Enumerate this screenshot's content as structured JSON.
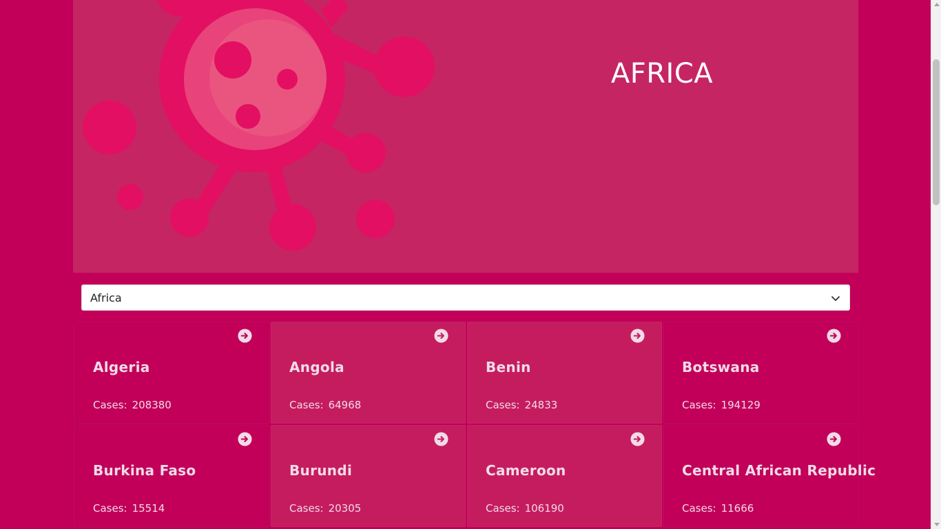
{
  "hero": {
    "title": "AFRICA",
    "illustration": "virus-icon"
  },
  "region_select": {
    "selected": "Africa",
    "icon": "chevron-down-icon"
  },
  "cards": [
    {
      "name": "Algeria",
      "cases_label": "Cases:",
      "cases": "208380",
      "icon": "arrow-right-circle-icon"
    },
    {
      "name": "Angola",
      "cases_label": "Cases:",
      "cases": "64968",
      "icon": "arrow-right-circle-icon"
    },
    {
      "name": "Benin",
      "cases_label": "Cases:",
      "cases": "24833",
      "icon": "arrow-right-circle-icon"
    },
    {
      "name": "Botswana",
      "cases_label": "Cases:",
      "cases": "194129",
      "icon": "arrow-right-circle-icon"
    },
    {
      "name": "Burkina Faso",
      "cases_label": "Cases:",
      "cases": "15514",
      "icon": "arrow-right-circle-icon"
    },
    {
      "name": "Burundi",
      "cases_label": "Cases:",
      "cases": "20305",
      "icon": "arrow-right-circle-icon"
    },
    {
      "name": "Cameroon",
      "cases_label": "Cases:",
      "cases": "106190",
      "icon": "arrow-right-circle-icon"
    },
    {
      "name": "Central African Republic",
      "cases_label": "Cases:",
      "cases": "11666",
      "icon": "arrow-right-circle-icon"
    }
  ],
  "colors": {
    "page_background": "#c2005a",
    "hero_background": "#c52563",
    "virus_color": "#e30f63",
    "virus_core": "#ea557f",
    "card_text": "#f2dbe7"
  }
}
